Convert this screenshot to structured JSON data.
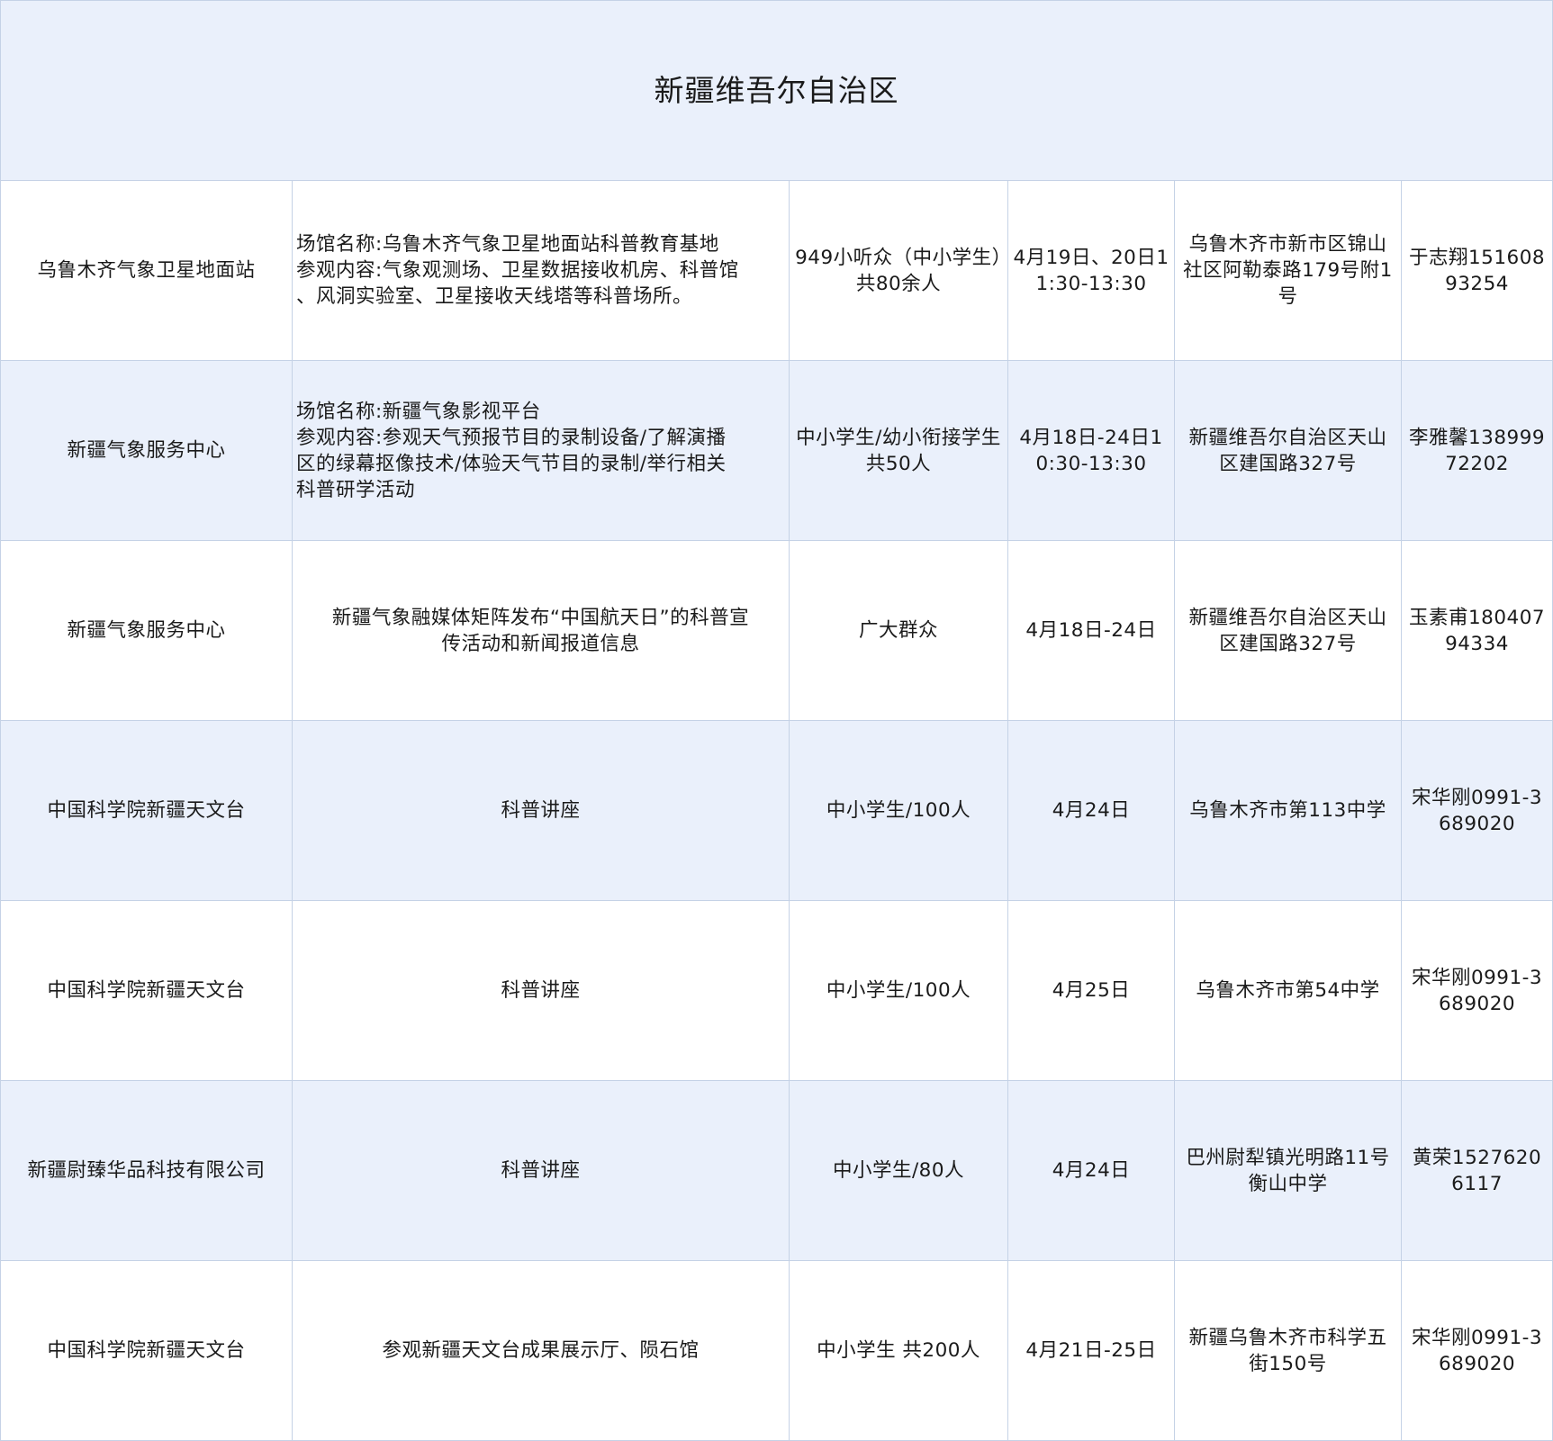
{
  "title": "新疆维吾尔自治区",
  "rows": [
    {
      "organizer": "乌鲁木齐气象卫星地面站",
      "content_lines": [
        "场馆名称:乌鲁木齐气象卫星地面站科普教育基地",
        "参观内容:气象观测场、卫星数据接收机房、科普馆",
        "、风洞实验室、卫星接收天线塔等科普场所。"
      ],
      "content_align": "left",
      "audience": "949小听众（中小学生）共80余人",
      "time_lines": [
        "4月19日、20日",
        "11:30-13:30"
      ],
      "location": "乌鲁木齐市新市区锦山社区阿勒泰路179号附1号",
      "contact_name": "于志翔",
      "contact_phone": "15160893254",
      "shaded": false
    },
    {
      "organizer": "新疆气象服务中心",
      "content_lines": [
        "场馆名称:新疆气象影视平台",
        "参观内容:参观天气预报节目的录制设备/了解演播",
        "区的绿幕抠像技术/体验天气节目的录制/举行相关",
        "科普研学活动"
      ],
      "content_align": "left",
      "audience": "中小学生/幼小衔接学生共50人",
      "time_lines": [
        "4月18日-24日",
        "10:30-13:30"
      ],
      "location": "新疆维吾尔自治区天山区建国路327号",
      "contact_name": "李雅馨",
      "contact_phone": "13899972202",
      "shaded": true
    },
    {
      "organizer": "新疆气象服务中心",
      "content_lines": [
        "新疆气象融媒体矩阵发布“中国航天日”的科普宣",
        "传活动和新闻报道信息"
      ],
      "content_align": "center",
      "audience": "广大群众",
      "time_lines": [
        "4月18日-24日"
      ],
      "location": "新疆维吾尔自治区天山区建国路327号",
      "contact_name": "玉素甫",
      "contact_phone": "18040794334",
      "shaded": false
    },
    {
      "organizer": "中国科学院新疆天文台",
      "content_lines": [
        "科普讲座"
      ],
      "content_align": "center",
      "audience": "中小学生/100人",
      "time_lines": [
        "4月24日"
      ],
      "location": "乌鲁木齐市第113中学",
      "contact_name": "宋华刚",
      "contact_phone": "0991-3689020",
      "shaded": true
    },
    {
      "organizer": "中国科学院新疆天文台",
      "content_lines": [
        "科普讲座"
      ],
      "content_align": "center",
      "audience": "中小学生/100人",
      "time_lines": [
        "4月25日"
      ],
      "location": "乌鲁木齐市第54中学",
      "contact_name": "宋华刚",
      "contact_phone": "0991-3689020",
      "shaded": false
    },
    {
      "organizer": "新疆尉臻华品科技有限公司",
      "content_lines": [
        "科普讲座"
      ],
      "content_align": "center",
      "audience": "中小学生/80人",
      "time_lines": [
        "4月24日"
      ],
      "location": "巴州尉犁镇光明路11号衡山中学",
      "contact_name": "黄荣",
      "contact_phone": "15276206117",
      "shaded": true
    },
    {
      "organizer": "中国科学院新疆天文台",
      "content_lines": [
        "参观新疆天文台成果展示厅、陨石馆"
      ],
      "content_align": "center",
      "audience": "中小学生 共200人",
      "time_lines": [
        "4月21日-25日"
      ],
      "location": "新疆乌鲁木齐市科学五街150号",
      "contact_name": "宋华刚",
      "contact_phone": "0991-3689020",
      "shaded": false
    }
  ]
}
